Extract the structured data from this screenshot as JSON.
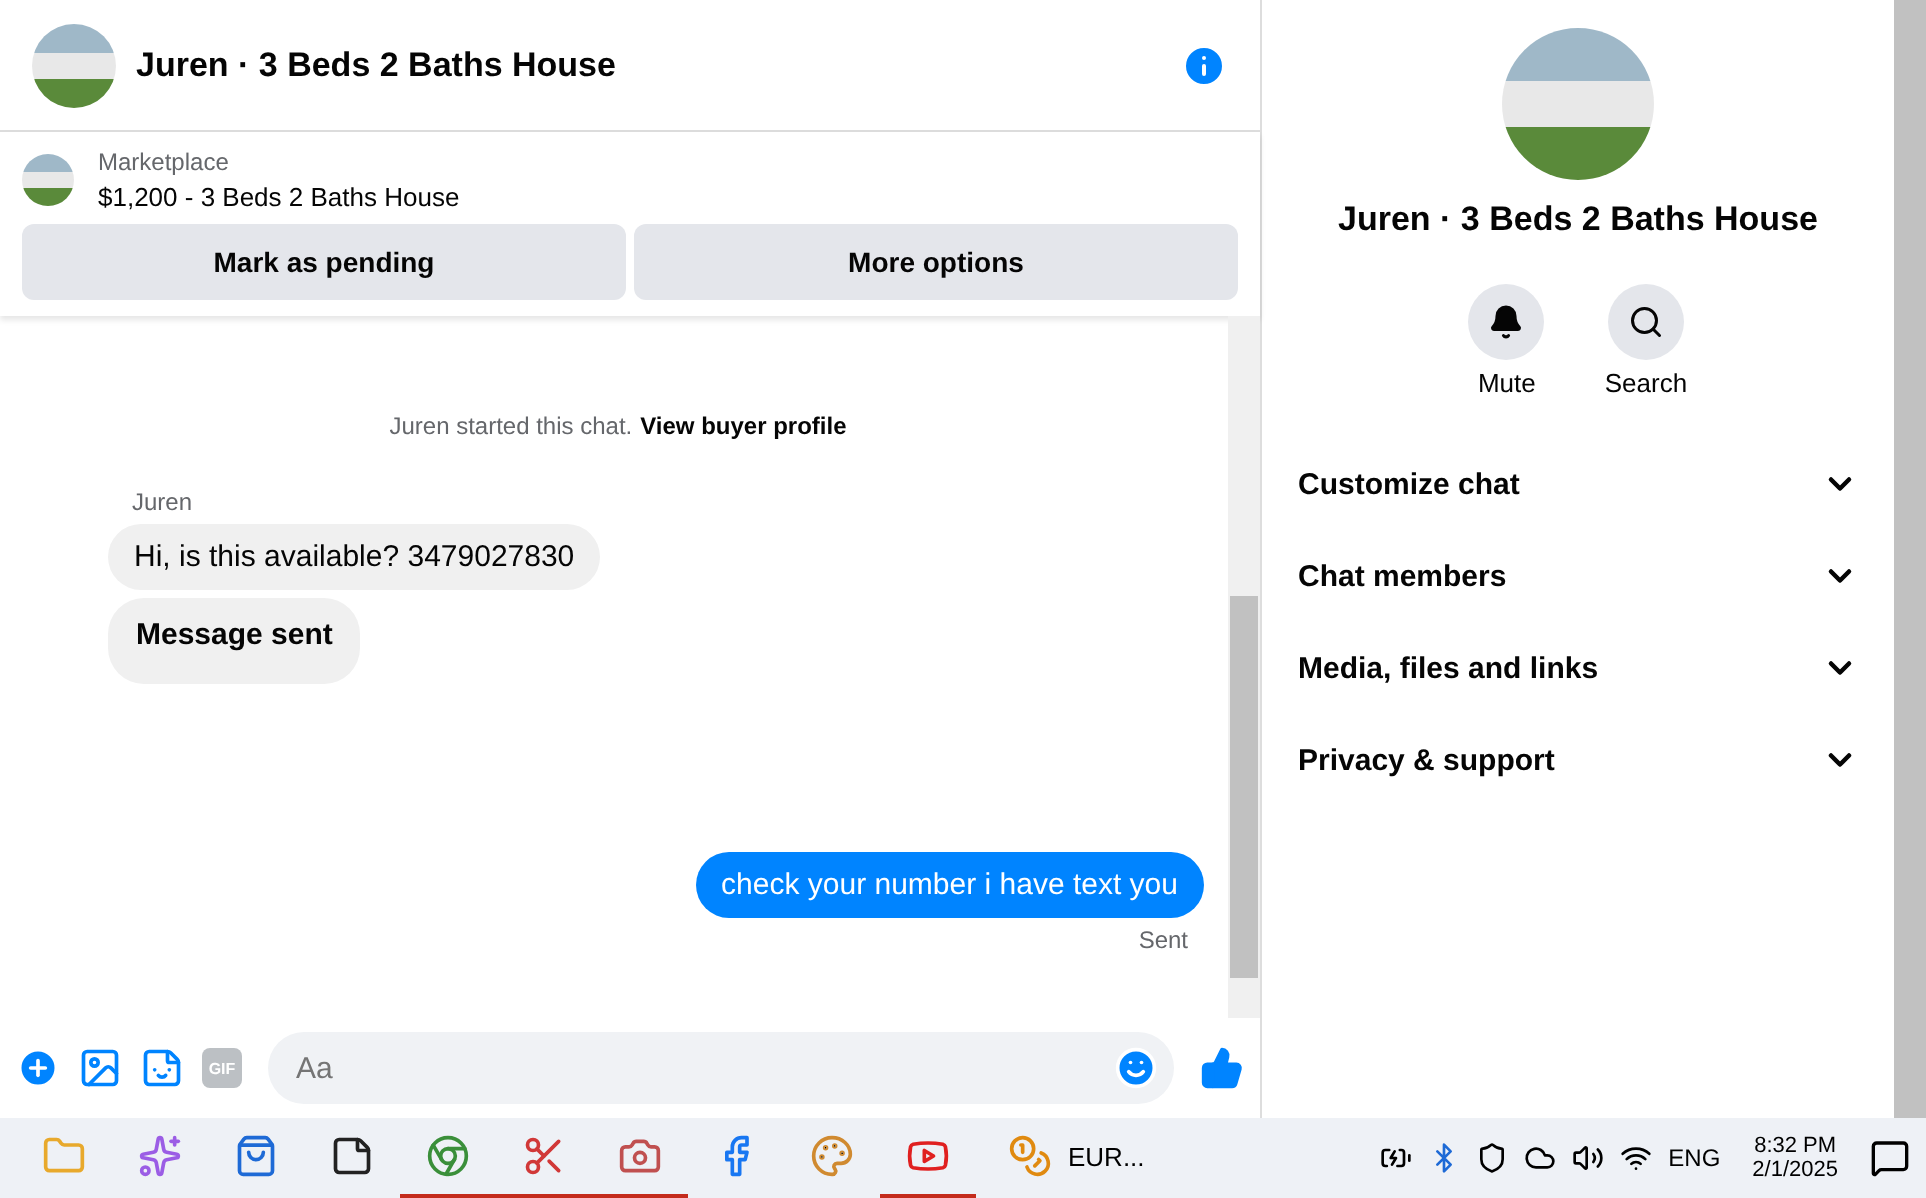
{
  "header": {
    "title": "Juren · 3 Beds 2 Baths House"
  },
  "listing": {
    "source": "Marketplace",
    "title": "$1,200 - 3 Beds 2 Baths House",
    "buttons": [
      "Mark as pending",
      "More options"
    ]
  },
  "chat": {
    "notice": "Juren started this chat.",
    "notice_link": "View buyer profile",
    "sender": "Juren",
    "messages": [
      {
        "kind": "incoming",
        "text": "Hi, is this available? 3479027830",
        "bold": false
      },
      {
        "kind": "incoming",
        "text": "Message sent",
        "bold": true
      },
      {
        "kind": "outgoing",
        "text": "check your number i have text you",
        "bold": false
      }
    ],
    "status": "Sent"
  },
  "composer": {
    "placeholder": "Aa",
    "gif_label": "GIF"
  },
  "details": {
    "title": "Juren · 3 Beds 2 Baths House",
    "actions": [
      {
        "kind": "bell",
        "label": "Mute"
      },
      {
        "kind": "search",
        "label": "Search"
      }
    ],
    "sections": [
      {
        "label": "Customize chat",
        "expanded": false
      },
      {
        "label": "Chat members",
        "expanded": false
      },
      {
        "label": "Media, files and links",
        "expanded": false
      },
      {
        "label": "Privacy & support",
        "expanded": false
      }
    ]
  },
  "taskbar": {
    "apps": [
      {
        "kind": "folder",
        "running": false
      },
      {
        "kind": "sparkle",
        "running": false
      },
      {
        "kind": "store",
        "running": false
      },
      {
        "kind": "notes",
        "running": false
      },
      {
        "kind": "browser",
        "running": true
      },
      {
        "kind": "scissors",
        "running": true
      },
      {
        "kind": "camera",
        "running": true
      },
      {
        "kind": "facebook",
        "running": false
      },
      {
        "kind": "palette",
        "running": false
      },
      {
        "kind": "video",
        "running": true
      }
    ],
    "coin_label": "EUR...",
    "language": "ENG",
    "time": "8:32 PM",
    "date": "2/1/2025"
  }
}
